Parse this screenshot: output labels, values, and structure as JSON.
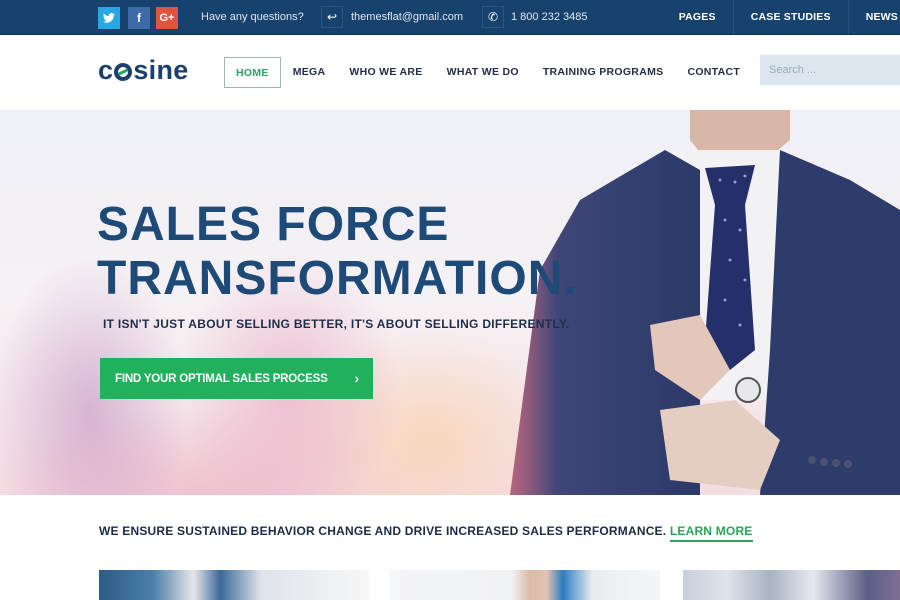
{
  "topbar": {
    "social": [
      {
        "name": "twitter",
        "glyph": "🐦"
      },
      {
        "name": "facebook",
        "glyph": "f"
      },
      {
        "name": "google-plus",
        "glyph": "G+"
      }
    ],
    "question_text": "Have any questions?",
    "email": "themesflat@gmail.com",
    "phone": "1 800 232 3485",
    "reply_glyph": "↩",
    "phone_glyph": "✆",
    "nav": [
      "PAGES",
      "CASE STUDIES",
      "NEWS"
    ],
    "background_color": "#18426e"
  },
  "header": {
    "logo": {
      "prefix": "c",
      "suffix": "sine"
    },
    "nav": [
      {
        "label": "HOME",
        "active": true
      },
      {
        "label": "MEGA",
        "active": false
      },
      {
        "label": "WHO WE ARE",
        "active": false
      },
      {
        "label": "WHAT WE DO",
        "active": false
      },
      {
        "label": "TRAINING PROGRAMS",
        "active": false
      },
      {
        "label": "CONTACT",
        "active": false
      }
    ],
    "search_placeholder": "Search ..."
  },
  "hero": {
    "title_line1": "SALES FORCE",
    "title_line2": "TRANSFORMATION.",
    "subtitle": "IT ISN'T JUST ABOUT SELLING BETTER, IT'S ABOUT SELLING DIFFERENTLY.",
    "cta_label": "FIND YOUR OPTIMAL SALES PROCESS",
    "cta_chevron": "›",
    "accent_color": "#21b15d",
    "title_color": "#1e4a78"
  },
  "intro": {
    "tagline": "WE ENSURE SUSTAINED BEHAVIOR CHANGE AND DRIVE INCREASED SALES PERFORMANCE.",
    "learn_more": "LEARN MORE"
  }
}
